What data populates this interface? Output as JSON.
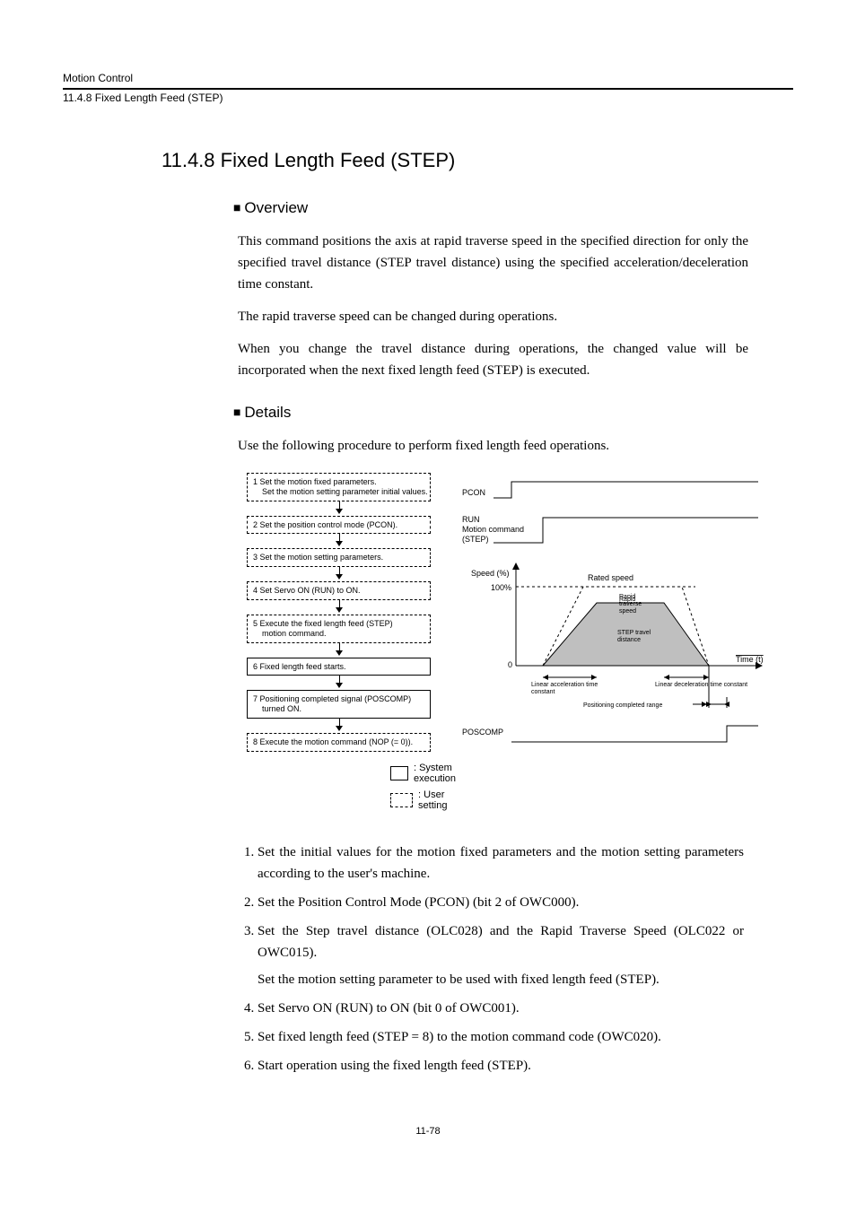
{
  "header": {
    "top": "Motion Control",
    "sub": "11.4.8  Fixed Length Feed (STEP)"
  },
  "title": "11.4.8  Fixed Length Feed (STEP)",
  "overview": {
    "heading": "Overview",
    "p1": "This command positions the axis at rapid traverse speed in the specified direction for only the specified travel distance (STEP travel distance) using the specified acceleration/deceleration time constant.",
    "p2": "The rapid traverse speed can be changed during operations.",
    "p3": "When you change the travel distance during operations, the changed value will be incorporated when the next fixed length feed (STEP) is executed."
  },
  "details": {
    "heading": "Details",
    "intro": "Use the following procedure to perform fixed length feed operations.",
    "flow": {
      "b1a": "1  Set the motion fixed parameters.",
      "b1b": "    Set the motion setting parameter initial values.",
      "b2": "2 Set the position control mode (PCON).",
      "b3": "3 Set the motion setting parameters.",
      "b4": "4 Set Servo ON (RUN) to ON.",
      "b5a": "5  Execute the fixed length feed (STEP)",
      "b5b": "    motion command.",
      "b6": "6 Fixed length feed starts.",
      "b7a": "7  Positioning completed signal (POSCOMP)",
      "b7b": "    turned ON.",
      "b8": "8 Execute the motion command (NOP (= 0))."
    },
    "timing": {
      "pcon": "PCON",
      "run": "RUN",
      "motion_command": "Motion command",
      "step": "(STEP)",
      "speed_pct": "Speed (%)",
      "hundred": "100%",
      "zero": "0",
      "rated_speed": "Rated speed",
      "rapid_traverse_speed": "Rapid traverse speed",
      "step_travel_distance": "STEP travel distance",
      "time_t": "Time (t)",
      "lin_accel": "Linear acceleration time constant",
      "lin_decel": "Linear deceleration time constant",
      "pos_range": "Positioning completed range",
      "poscomp": "POSCOMP"
    },
    "legend": {
      "system": ": System execution",
      "user": ": User setting"
    },
    "list": {
      "i1": "Set the initial values for the motion fixed parameters and the motion setting parameters according to the user's machine.",
      "i2": "Set the Position Control Mode (PCON) (bit 2 of OWC000).",
      "i3": "Set the Step travel distance (OLC028) and the Rapid Traverse Speed (OLC022 or OWC015).",
      "i3b": "Set the motion setting parameter to be used with fixed length feed (STEP).",
      "i4": "Set Servo ON (RUN) to ON (bit 0 of OWC001).",
      "i5": "Set fixed length feed (STEP = 8) to the motion command code (OWC020).",
      "i6": "Start operation using the fixed length feed (STEP)."
    }
  },
  "footer": "11-78"
}
